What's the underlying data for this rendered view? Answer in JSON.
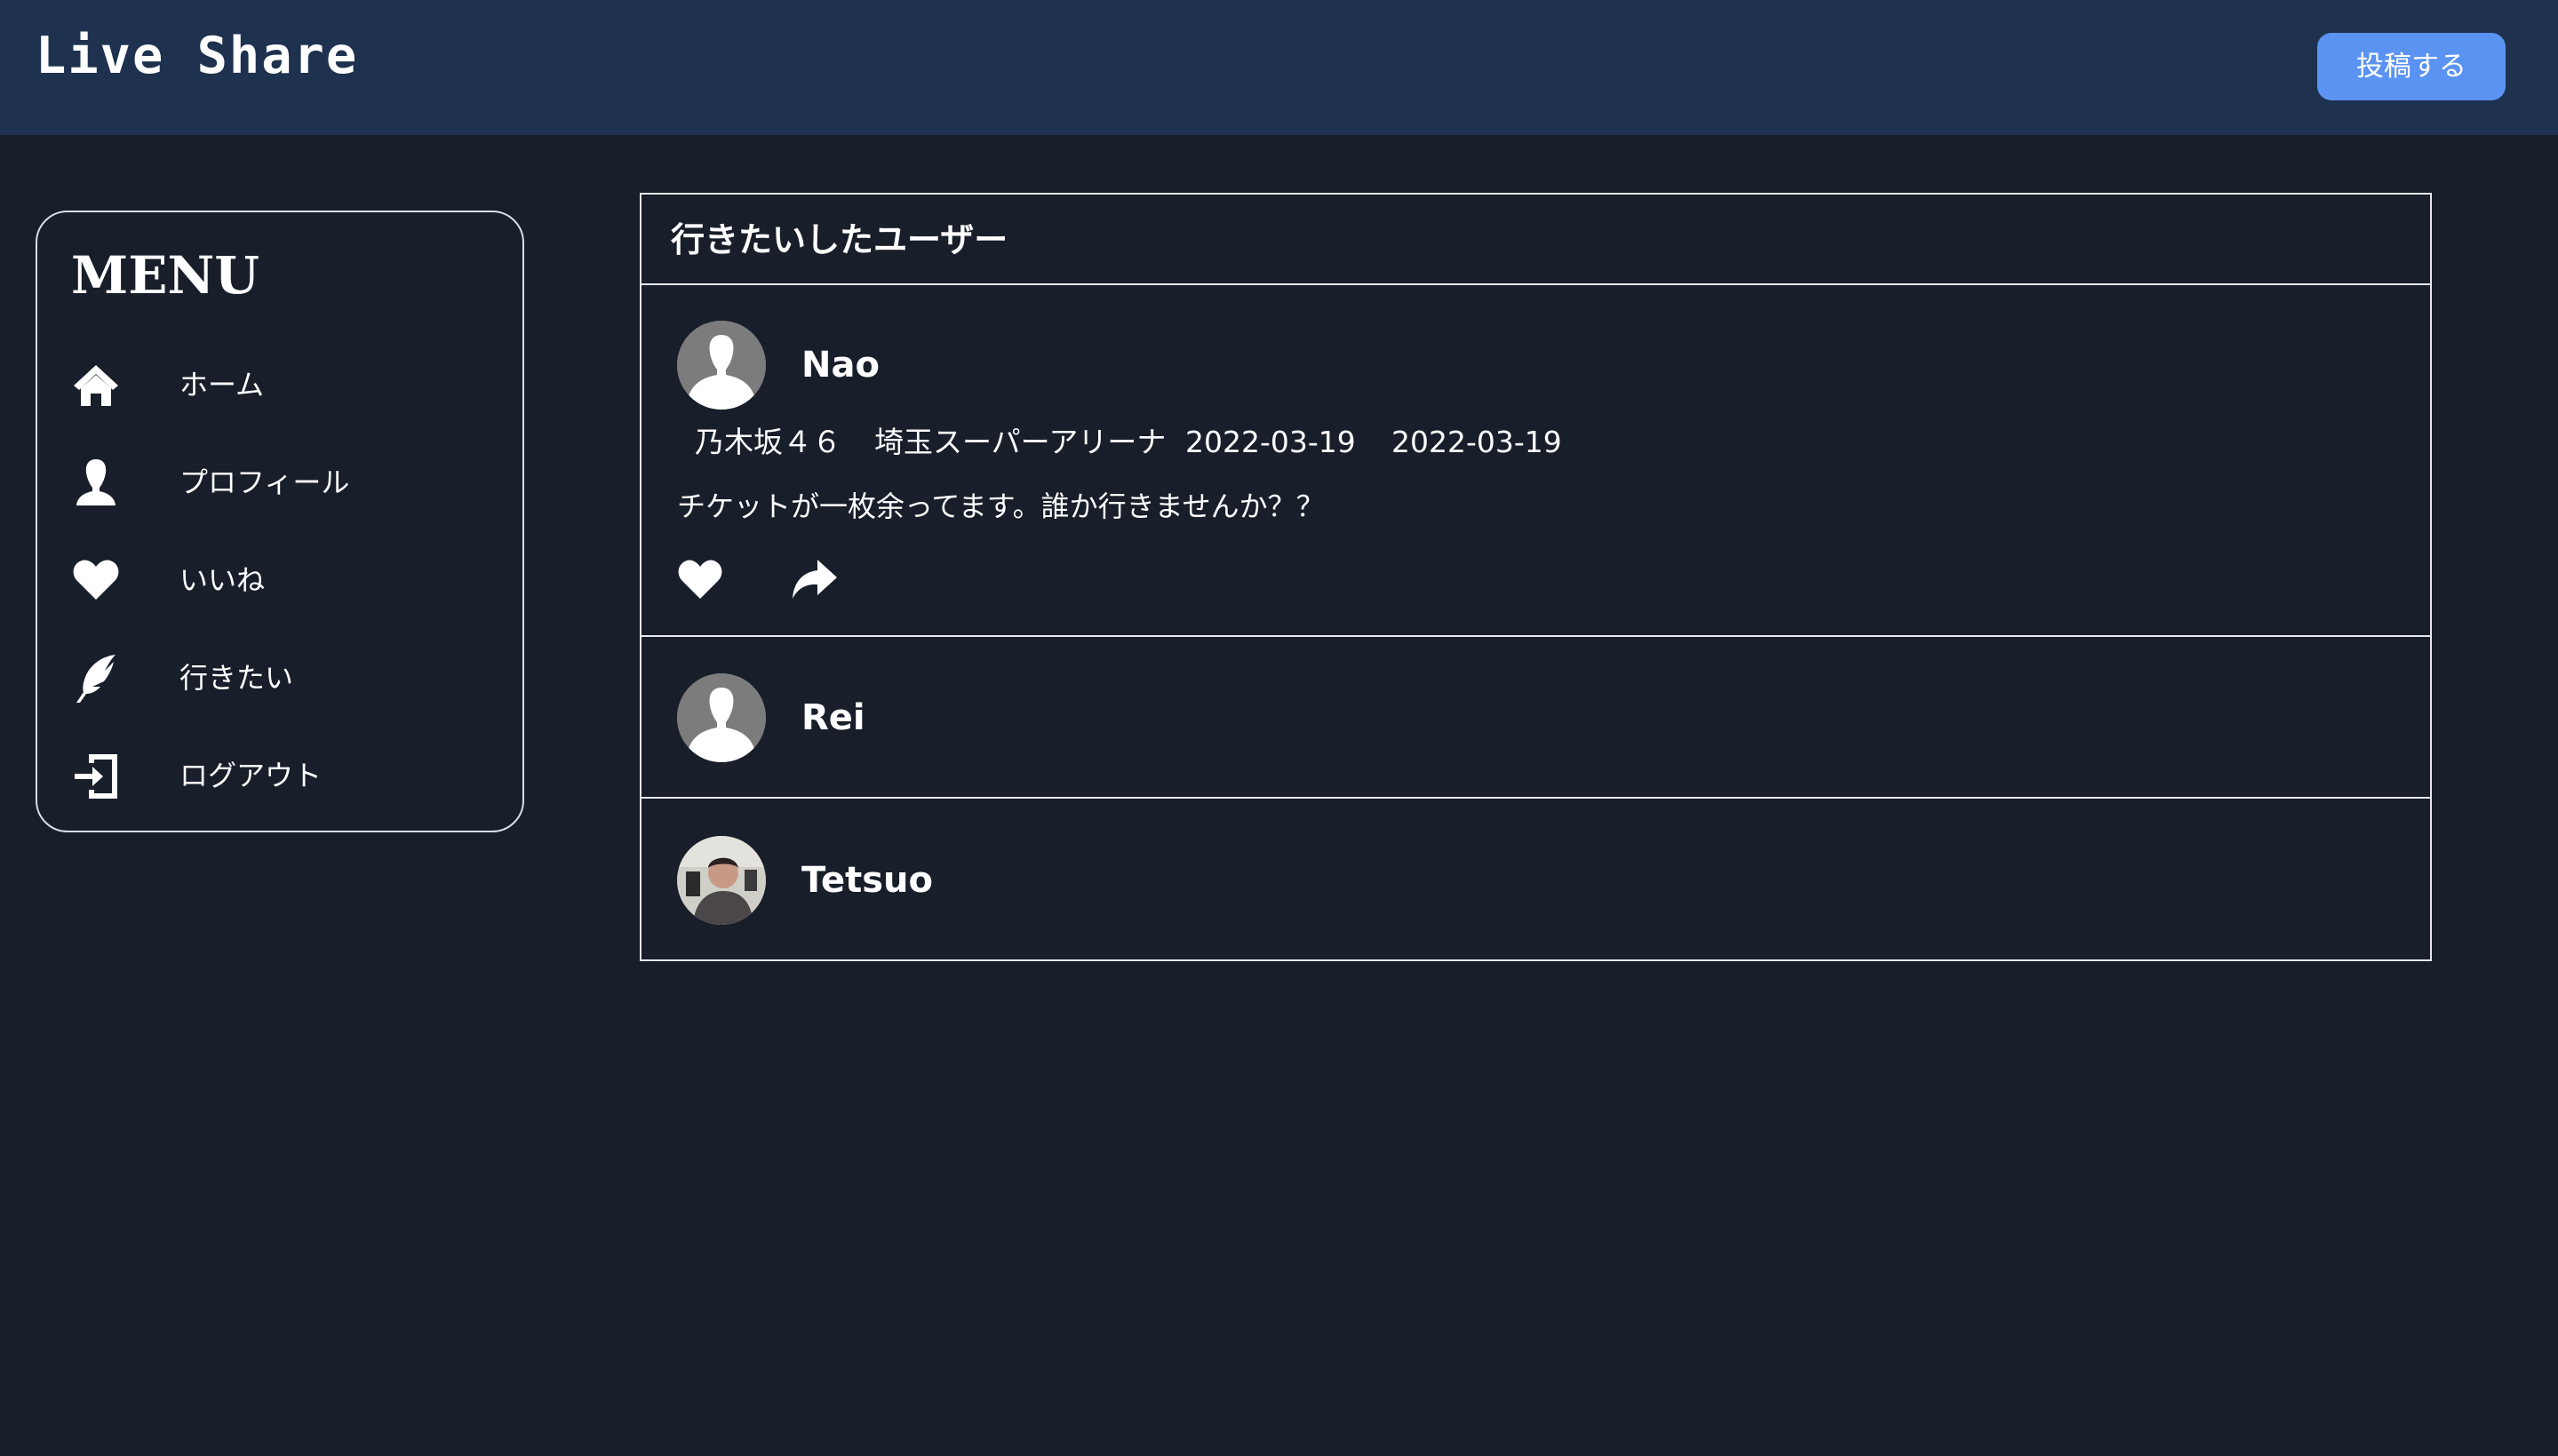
{
  "app": {
    "title": "Live Share",
    "post_button": "投稿する"
  },
  "menu": {
    "title": "MENU",
    "items": [
      {
        "label": "ホーム",
        "icon": "home-icon"
      },
      {
        "label": "プロフィール",
        "icon": "user-icon"
      },
      {
        "label": "いいね",
        "icon": "heart-icon"
      },
      {
        "label": "行きたい",
        "icon": "feather-icon"
      },
      {
        "label": "ログアウト",
        "icon": "logout-icon"
      }
    ]
  },
  "panel": {
    "title": "行きたいしたユーザー",
    "users": [
      {
        "name": "Nao",
        "avatar": "default-avatar",
        "artist": "乃木坂４６",
        "venue": "埼玉スーパーアリーナ",
        "date_start": "2022-03-19",
        "date_end": "2022-03-19",
        "message": "チケットが一枚余ってます。誰か行きませんか？？"
      },
      {
        "name": "Rei",
        "avatar": "default-avatar"
      },
      {
        "name": "Tetsuo",
        "avatar": "photo-avatar"
      }
    ]
  },
  "colors": {
    "background": "#181e2a",
    "header": "#1e324f",
    "accent_button": "#5b93f2",
    "text": "#ffffff",
    "avatar_placeholder": "#7c7c7c"
  }
}
